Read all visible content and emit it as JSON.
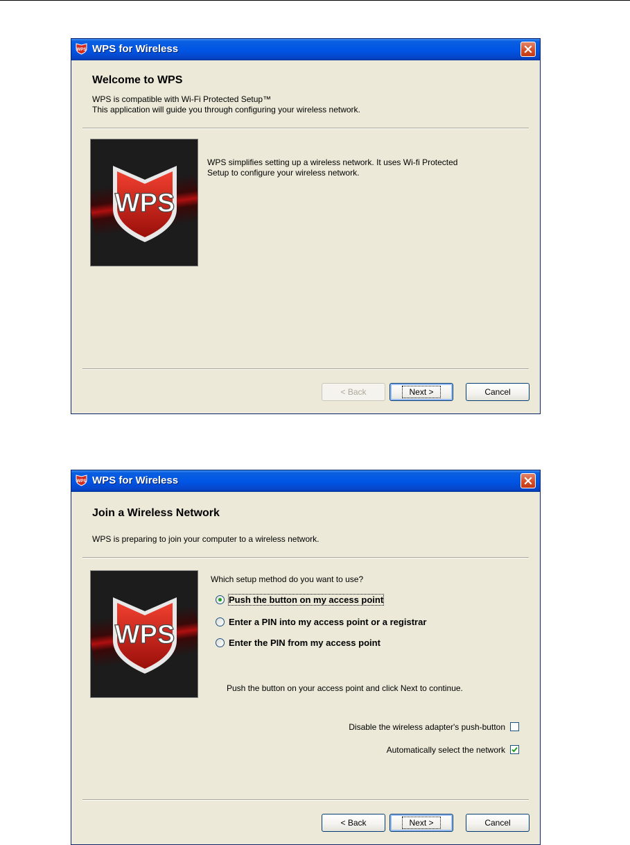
{
  "dialogs": [
    {
      "window_title": "WPS for Wireless",
      "header_title": "Welcome to WPS",
      "header_line1": "WPS is compatible with Wi-Fi Protected Setup™",
      "header_line2": "This application will guide you through configuring your wireless network.",
      "logo_text": "WPS",
      "body_line1": "WPS simplifies setting up a wireless network. It uses Wi-fi Protected",
      "body_line2": "Setup to configure your wireless network.",
      "buttons": {
        "back": "< Back",
        "back_enabled": false,
        "next": "Next >",
        "cancel": "Cancel"
      }
    },
    {
      "window_title": "WPS for Wireless",
      "header_title": "Join a Wireless Network",
      "header_line1": "WPS is preparing to join your computer to a wireless network.",
      "logo_text": "WPS",
      "question": "Which setup method do you want to use?",
      "options": [
        {
          "label": "Push the button on my access point",
          "selected": true
        },
        {
          "label": "Enter a PIN into my access point or a registrar",
          "selected": false
        },
        {
          "label": "Enter the PIN from my access point",
          "selected": false
        }
      ],
      "instruction": "Push the button on your access point and click Next to continue.",
      "checkboxes": [
        {
          "label": "Disable the wireless adapter's push-button",
          "checked": false
        },
        {
          "label": "Automatically select the network",
          "checked": true
        }
      ],
      "buttons": {
        "back": "< Back",
        "back_enabled": true,
        "next": "Next >",
        "cancel": "Cancel"
      }
    }
  ],
  "colors": {
    "titlebar": "#0055e5",
    "dialog_bg": "#ece9d8",
    "close_button": "#d44b25",
    "logo_red": "#d42a1f"
  }
}
